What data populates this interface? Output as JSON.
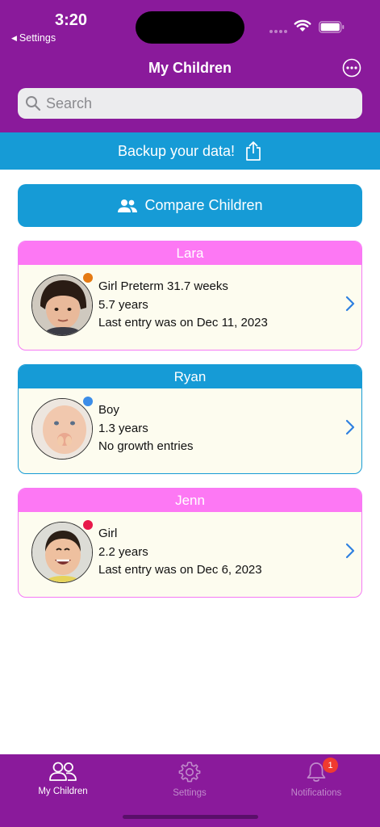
{
  "status_bar": {
    "time": "3:20",
    "back_label": "Settings"
  },
  "nav": {
    "title": "My Children"
  },
  "search": {
    "placeholder": "Search"
  },
  "backup_banner": {
    "label": "Backup your data!"
  },
  "compare_button": {
    "label": "Compare Children"
  },
  "children": [
    {
      "name": "Lara",
      "line1": "Girl Preterm 31.7 weeks",
      "line2": "5.7 years",
      "line3": "Last entry was on Dec 11, 2023",
      "dot_color": "#e57a12",
      "theme": "pink"
    },
    {
      "name": "Ryan",
      "line1": "Boy",
      "line2": "1.3 years",
      "line3": "No growth entries",
      "dot_color": "#3c8de8",
      "theme": "blue"
    },
    {
      "name": "Jenn",
      "line1": "Girl",
      "line2": "2.2 years",
      "line3": "Last entry was on Dec 6, 2023",
      "dot_color": "#e8194a",
      "theme": "pink"
    }
  ],
  "tabbar": {
    "items": [
      {
        "label": "My Children",
        "icon": "people-icon"
      },
      {
        "label": "Settings",
        "icon": "gear-icon"
      },
      {
        "label": "Notifications",
        "icon": "bell-icon",
        "badge": "1"
      }
    ]
  },
  "colors": {
    "purple": "#8a1a9b",
    "blue": "#169bd6",
    "pink": "#fd78f4",
    "card_bg": "#fdfcef"
  }
}
